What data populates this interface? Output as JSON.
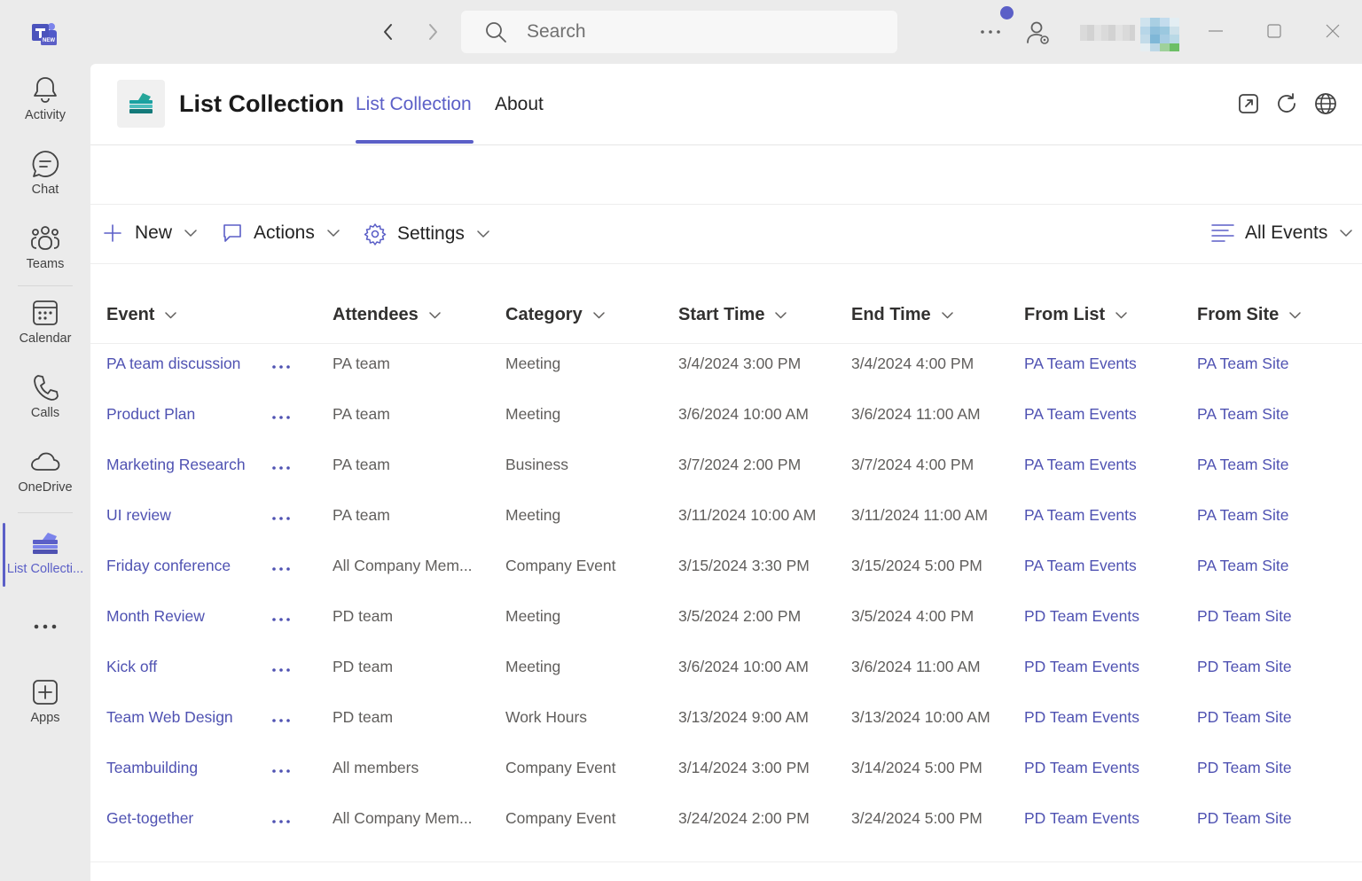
{
  "titlebar": {
    "search_placeholder": "Search",
    "logo_badge": "NEW"
  },
  "rail": {
    "items": [
      {
        "label": "Activity",
        "icon": "bell-icon"
      },
      {
        "label": "Chat",
        "icon": "chat-icon"
      },
      {
        "label": "Teams",
        "icon": "teams-icon"
      },
      {
        "label": "Calendar",
        "icon": "calendar-icon"
      },
      {
        "label": "Calls",
        "icon": "phone-icon"
      },
      {
        "label": "OneDrive",
        "icon": "cloud-icon"
      },
      {
        "label": "List Collecti...",
        "icon": "list-collection-icon",
        "active": true
      },
      {
        "label": "Apps",
        "icon": "add-app-icon"
      }
    ]
  },
  "app": {
    "title": "List Collection",
    "tabs": [
      {
        "label": "List Collection",
        "active": true
      },
      {
        "label": "About",
        "active": false
      }
    ]
  },
  "commandbar": {
    "new_label": "New",
    "actions_label": "Actions",
    "settings_label": "Settings",
    "view_label": "All Events"
  },
  "table": {
    "columns": [
      "Event",
      "Attendees",
      "Category",
      "Start Time",
      "End Time",
      "From List",
      "From Site"
    ],
    "rows": [
      {
        "event": "PA team discussion",
        "attendees": "PA team",
        "category": "Meeting",
        "start": "3/4/2024 3:00 PM",
        "end": "3/4/2024 4:00 PM",
        "list": "PA Team Events",
        "site": "PA Team Site"
      },
      {
        "event": "Product Plan",
        "attendees": "PA team",
        "category": "Meeting",
        "start": "3/6/2024 10:00 AM",
        "end": "3/6/2024 11:00 AM",
        "list": "PA Team Events",
        "site": "PA Team Site"
      },
      {
        "event": "Marketing Research",
        "attendees": "PA team",
        "category": "Business",
        "start": "3/7/2024 2:00 PM",
        "end": "3/7/2024 4:00 PM",
        "list": "PA Team Events",
        "site": "PA Team Site"
      },
      {
        "event": "UI review",
        "attendees": "PA team",
        "category": "Meeting",
        "start": "3/11/2024 10:00 AM",
        "end": "3/11/2024 11:00 AM",
        "list": "PA Team Events",
        "site": "PA Team Site"
      },
      {
        "event": "Friday conference",
        "attendees": "All Company Mem...",
        "category": "Company Event",
        "start": "3/15/2024 3:30 PM",
        "end": "3/15/2024 5:00 PM",
        "list": "PA Team Events",
        "site": "PA Team Site"
      },
      {
        "event": "Month Review",
        "attendees": "PD team",
        "category": "Meeting",
        "start": "3/5/2024 2:00 PM",
        "end": "3/5/2024 4:00 PM",
        "list": "PD Team Events",
        "site": "PD Team Site"
      },
      {
        "event": "Kick off",
        "attendees": "PD team",
        "category": "Meeting",
        "start": "3/6/2024 10:00 AM",
        "end": "3/6/2024 11:00 AM",
        "list": "PD Team Events",
        "site": "PD Team Site"
      },
      {
        "event": "Team Web Design",
        "attendees": "PD team",
        "category": "Work Hours",
        "start": "3/13/2024 9:00 AM",
        "end": "3/13/2024 10:00 AM",
        "list": "PD Team Events",
        "site": "PD Team Site"
      },
      {
        "event": "Teambuilding",
        "attendees": "All members",
        "category": "Company Event",
        "start": "3/14/2024 3:00 PM",
        "end": "3/14/2024 5:00 PM",
        "list": "PD Team Events",
        "site": "PD Team Site"
      },
      {
        "event": "Get-together",
        "attendees": "All Company Mem...",
        "category": "Company Event",
        "start": "3/24/2024 2:00 PM",
        "end": "3/24/2024 5:00 PM",
        "list": "PD Team Events",
        "site": "PD Team Site"
      }
    ]
  },
  "colors": {
    "accent": "#5b5fc7",
    "link": "#4f52b2",
    "rail_bg": "#ebebeb"
  }
}
